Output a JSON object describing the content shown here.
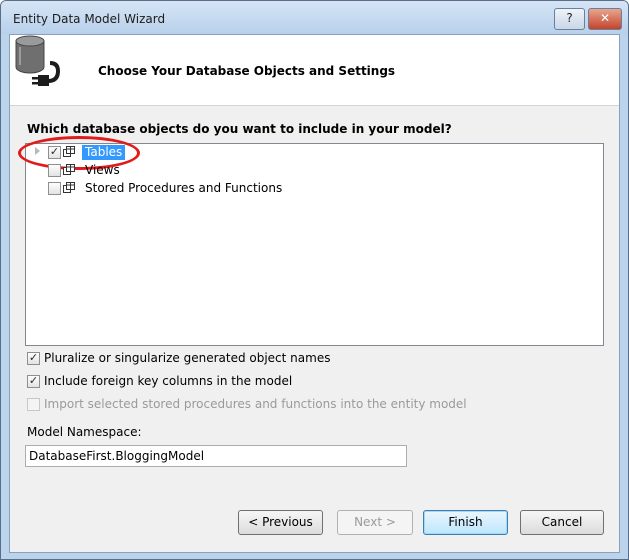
{
  "window": {
    "title": "Entity Data Model Wizard",
    "help_label": "?",
    "close_label": "✕"
  },
  "header": {
    "title": "Choose Your Database Objects and Settings",
    "icon": "database-plug-icon"
  },
  "prompt": "Which database objects do you want to include in your model?",
  "tree": {
    "items": [
      {
        "label": "Tables",
        "checked": true,
        "selected": true,
        "expandable": true
      },
      {
        "label": "Views",
        "checked": false,
        "selected": false,
        "expandable": false
      },
      {
        "label": "Stored Procedures and Functions",
        "checked": false,
        "selected": false,
        "expandable": false
      }
    ]
  },
  "options": [
    {
      "label": "Pluralize or singularize generated object names",
      "checked": true,
      "enabled": true
    },
    {
      "label": "Include foreign key columns in the model",
      "checked": true,
      "enabled": true
    },
    {
      "label": "Import selected stored procedures and functions into the entity model",
      "checked": false,
      "enabled": false
    }
  ],
  "namespace": {
    "label": "Model Namespace:",
    "value": "DatabaseFirst.BloggingModel"
  },
  "buttons": {
    "previous": "< Previous",
    "next": "Next >",
    "finish": "Finish",
    "cancel": "Cancel"
  },
  "colors": {
    "selection": "#3399ff",
    "annotation_ring": "#e11b1b",
    "title_bar": "#c4d8ef"
  }
}
